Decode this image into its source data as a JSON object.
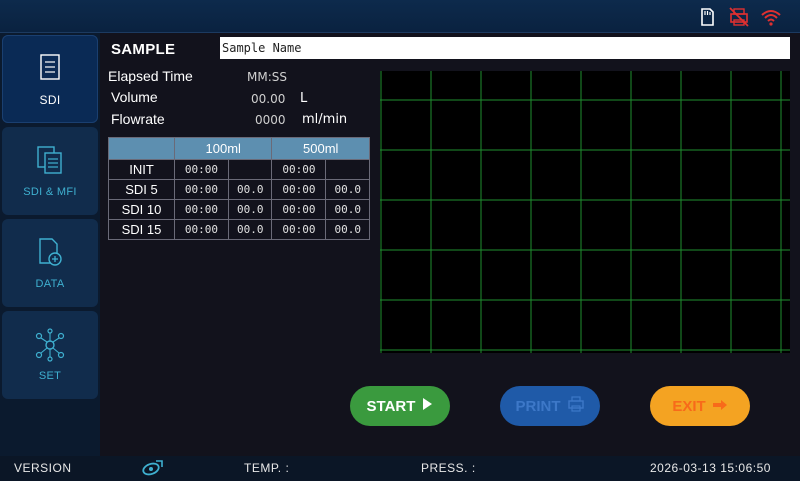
{
  "status_icons": [
    "sd-card-icon",
    "printer-disconnected-icon",
    "wifi-warning-icon"
  ],
  "colors": {
    "accent": "#3fb0d0",
    "grid": "#1f8f2f",
    "start": "#3a9a3e",
    "print": "#1f5aa8",
    "exit": "#f4a322"
  },
  "sidebar": {
    "items": [
      {
        "label": "SDI",
        "icon": "document-icon",
        "active": true
      },
      {
        "label": "SDI & MFI",
        "icon": "documents-icon",
        "active": false
      },
      {
        "label": "DATA",
        "icon": "file-add-icon",
        "active": false
      },
      {
        "label": "SET",
        "icon": "network-settings-icon",
        "active": false
      }
    ]
  },
  "sample": {
    "label": "SAMPLE",
    "value": "Sample Name"
  },
  "info": {
    "elapsed_label": "Elapsed Time",
    "elapsed_value": "MM:SS",
    "volume_label": "Volume",
    "volume_value": "00.00",
    "volume_unit": "L",
    "flowrate_label": "Flowrate",
    "flowrate_value": "0000",
    "flowrate_unit": "ml/min"
  },
  "table": {
    "headers": [
      "",
      "100ml",
      "500ml"
    ],
    "rows": [
      {
        "label": "INIT",
        "cells": [
          "00:00",
          "",
          "00:00",
          ""
        ]
      },
      {
        "label": "SDI 5",
        "cells": [
          "00:00",
          "00.0",
          "00:00",
          "00.0"
        ]
      },
      {
        "label": "SDI 10",
        "cells": [
          "00:00",
          "00.0",
          "00:00",
          "00.0"
        ]
      },
      {
        "label": "SDI 15",
        "cells": [
          "00:00",
          "00.0",
          "00:00",
          "00.0"
        ]
      }
    ]
  },
  "buttons": {
    "start": "START",
    "print": "PRINT",
    "exit": "EXIT"
  },
  "footer": {
    "version_label": "VERSION",
    "temp_label": "TEMP. :",
    "press_label": "PRESS. :",
    "datetime": "2026-03-13 15:06:50"
  }
}
